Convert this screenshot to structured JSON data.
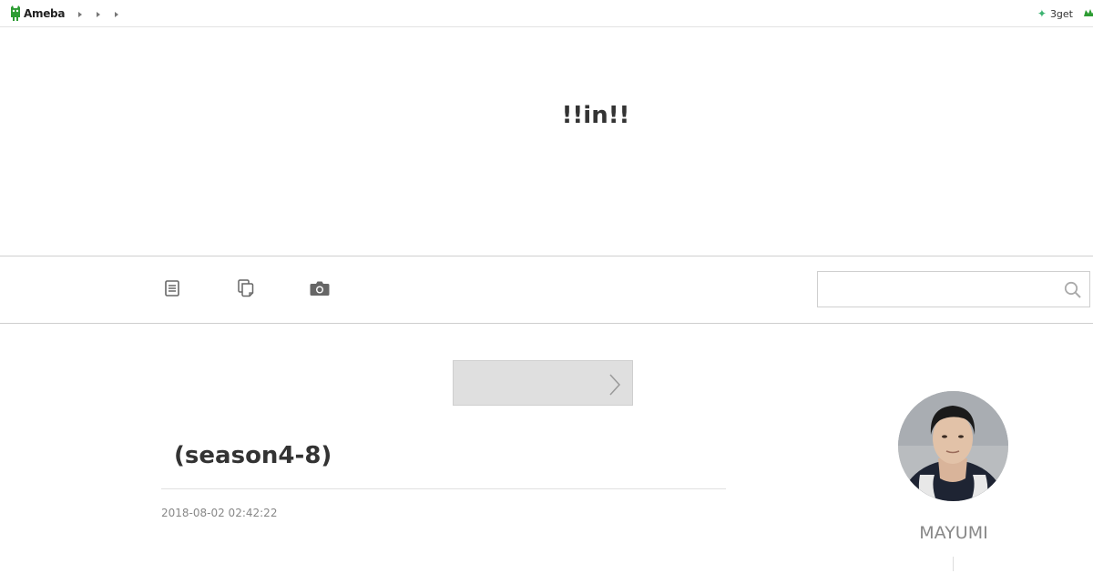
{
  "topbar": {
    "logo_text": "Ameba",
    "breadcrumbs": [
      "",
      "",
      ""
    ],
    "get_label": "3get"
  },
  "header": {
    "blog_title": "!!in!!"
  },
  "nav": {
    "items": [
      {
        "icon": "document-list-icon"
      },
      {
        "icon": "copy-pages-icon"
      },
      {
        "icon": "camera-icon"
      }
    ]
  },
  "search": {
    "value": "",
    "placeholder": ""
  },
  "entry": {
    "title": " (season4-8)",
    "date": "2018-08-02 02:42:22"
  },
  "profile": {
    "name": "MAYUMI"
  },
  "colors": {
    "brand_green": "#2d9c33",
    "sparkle_green": "#3cb371",
    "rule_gray": "#cfcfcf",
    "button_gray": "#dfdfdf",
    "muted_text": "#888888"
  }
}
